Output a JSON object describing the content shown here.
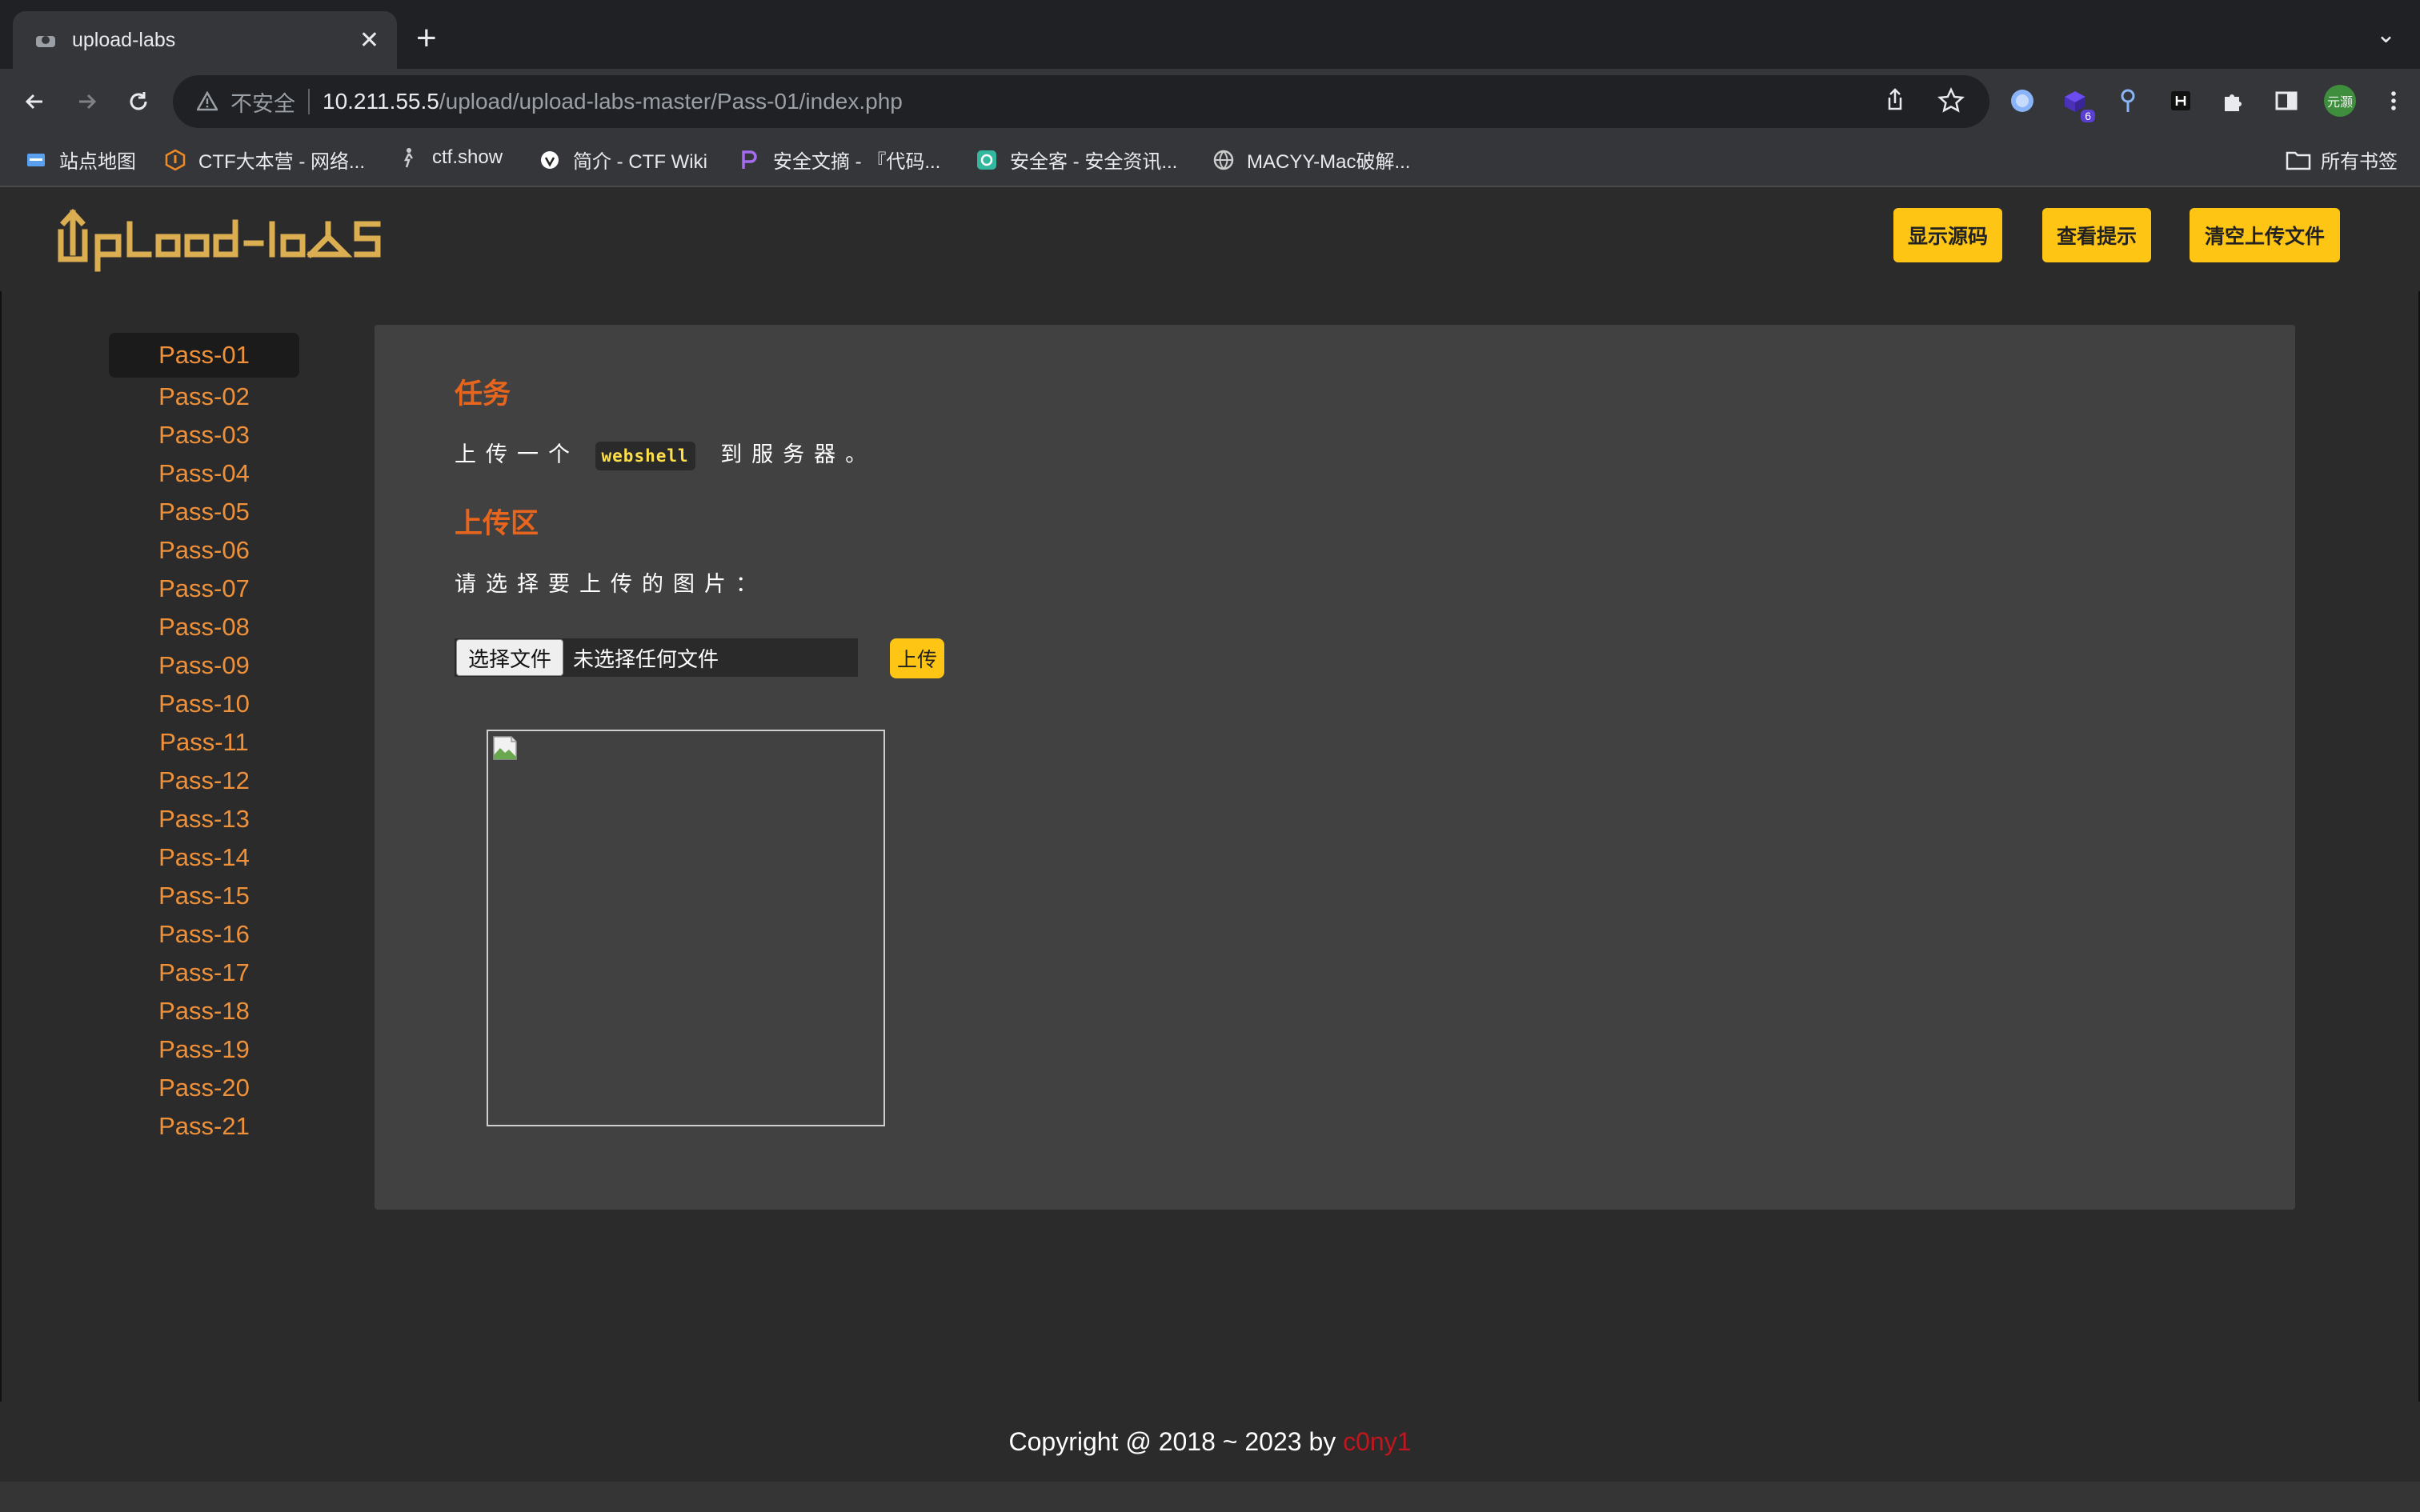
{
  "browser": {
    "tab_title": "upload-labs",
    "security_label": "不安全",
    "url_host": "10.211.55.5",
    "url_path": "/upload/upload-labs-master/Pass-01/index.php",
    "extension_badge": "6",
    "profile_label": "元灏",
    "bookmarks": [
      {
        "label": "站点地图",
        "icon": "sitemap-icon"
      },
      {
        "label": "CTF大本营 - 网络...",
        "icon": "ctf-camp-icon"
      },
      {
        "label": "ctf.show",
        "icon": "ctfshow-icon"
      },
      {
        "label": "简介 - CTF Wiki",
        "icon": "ctfwiki-icon"
      },
      {
        "label": "安全文摘 - 『代码...",
        "icon": "security-digest-icon"
      },
      {
        "label": "安全客 - 安全资讯...",
        "icon": "anquanke-icon"
      },
      {
        "label": "MACYY-Mac破解...",
        "icon": "globe-icon"
      }
    ],
    "all_bookmarks_label": "所有书签"
  },
  "header": {
    "logo_text": "Upload-labs",
    "buttons": {
      "show_source": "显示源码",
      "view_hint": "查看提示",
      "clear_uploads": "清空上传文件"
    }
  },
  "menu": {
    "items": [
      "Pass-01",
      "Pass-02",
      "Pass-03",
      "Pass-04",
      "Pass-05",
      "Pass-06",
      "Pass-07",
      "Pass-08",
      "Pass-09",
      "Pass-10",
      "Pass-11",
      "Pass-12",
      "Pass-13",
      "Pass-14",
      "Pass-15",
      "Pass-16",
      "Pass-17",
      "Pass-18",
      "Pass-19",
      "Pass-20",
      "Pass-21"
    ],
    "active": "Pass-01"
  },
  "task": {
    "heading": "任务",
    "text_before": "上传一个",
    "code": "webshell",
    "text_after": "到服务器。"
  },
  "upload": {
    "heading": "上传区",
    "prompt": "请选择要上传的图片：",
    "choose_button": "选择文件",
    "no_file": "未选择任何文件",
    "submit": "上传"
  },
  "footer": {
    "text": "Copyright @ 2018 ~ 2023 by ",
    "author": "c0ny1"
  },
  "colors": {
    "accent": "#ffc515",
    "heading": "#e8651e",
    "menu_link": "#f0913a",
    "author": "#c0161f"
  }
}
